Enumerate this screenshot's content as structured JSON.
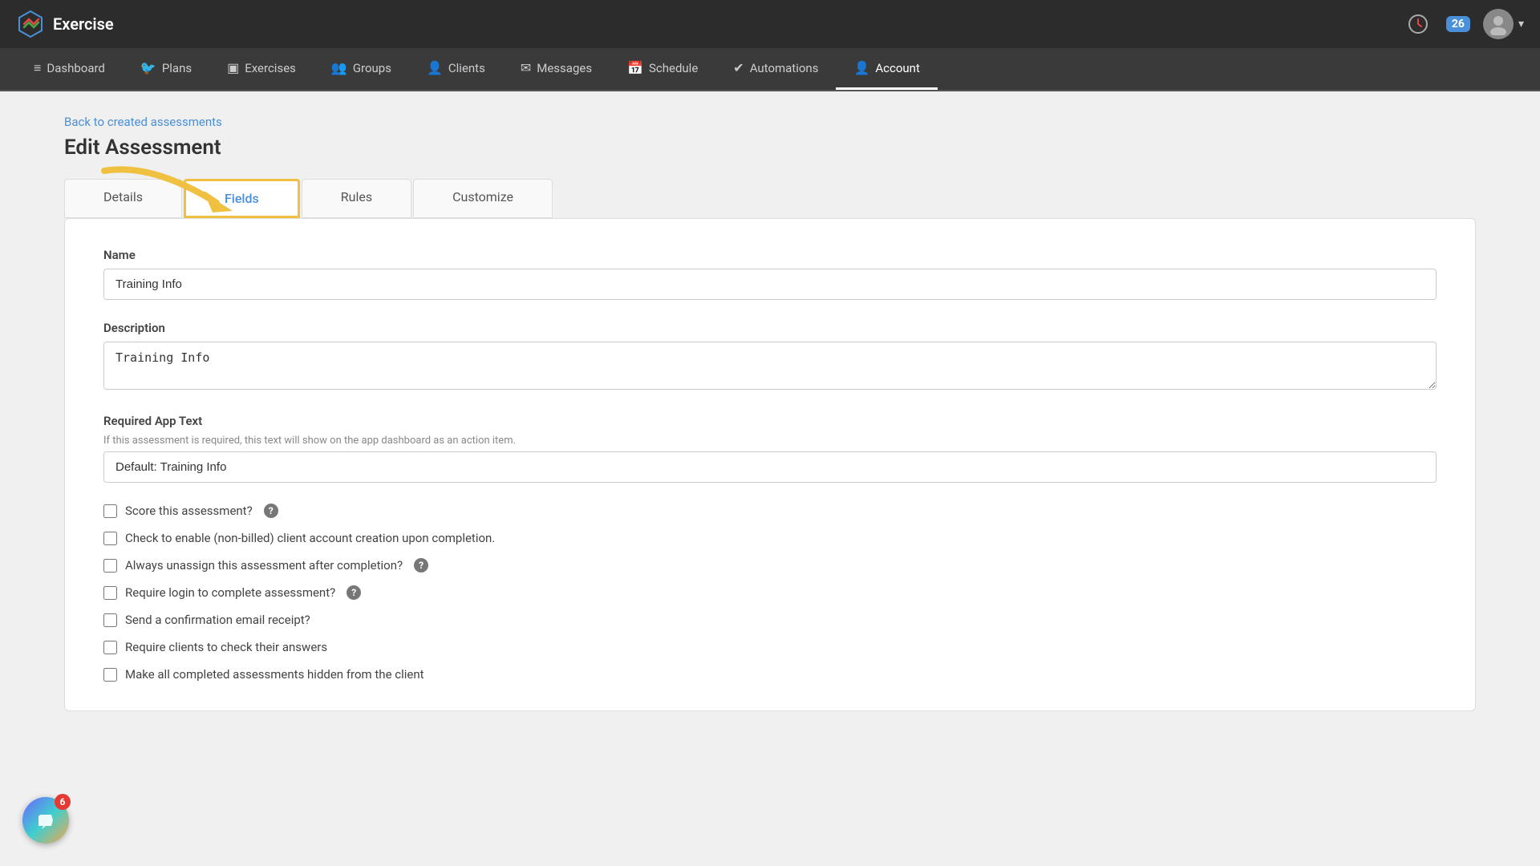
{
  "app": {
    "logo_text": "Exercise",
    "notification_count": "26"
  },
  "nav": {
    "items": [
      {
        "label": "Dashboard",
        "icon": "≡",
        "active": false
      },
      {
        "label": "Plans",
        "icon": "🐦",
        "active": false
      },
      {
        "label": "Exercises",
        "icon": "▣",
        "active": false
      },
      {
        "label": "Groups",
        "icon": "👥",
        "active": false
      },
      {
        "label": "Clients",
        "icon": "👤",
        "active": false
      },
      {
        "label": "Messages",
        "icon": "✉",
        "active": false
      },
      {
        "label": "Schedule",
        "icon": "📅",
        "active": false
      },
      {
        "label": "Automations",
        "icon": "✔",
        "active": false
      },
      {
        "label": "Account",
        "icon": "👤",
        "active": true
      }
    ]
  },
  "breadcrumb": "Back to created assessments",
  "page_title": "Edit Assessment",
  "tabs": [
    {
      "label": "Details",
      "active": false
    },
    {
      "label": "Fields",
      "active": true
    },
    {
      "label": "Rules",
      "active": false
    },
    {
      "label": "Customize",
      "active": false
    }
  ],
  "form": {
    "name_label": "Name",
    "name_value": "Training Info",
    "description_label": "Description",
    "description_value": "Training Info",
    "required_app_text_label": "Required App Text",
    "required_app_text_hint": "If this assessment is required, this text will show on the app dashboard as an action item.",
    "required_app_text_value": "Default: Training Info",
    "checkboxes": [
      {
        "label": "Score this assessment?",
        "has_help": true
      },
      {
        "label": "Check to enable (non-billed) client account creation upon completion.",
        "has_help": false
      },
      {
        "label": "Always unassign this assessment after completion?",
        "has_help": true
      },
      {
        "label": "Require login to complete assessment?",
        "has_help": true
      },
      {
        "label": "Send a confirmation email receipt?",
        "has_help": false
      },
      {
        "label": "Require clients to check their answers",
        "has_help": false
      },
      {
        "label": "Make all completed assessments hidden from the client",
        "has_help": false
      }
    ]
  },
  "chat_widget": {
    "badge": "6"
  }
}
